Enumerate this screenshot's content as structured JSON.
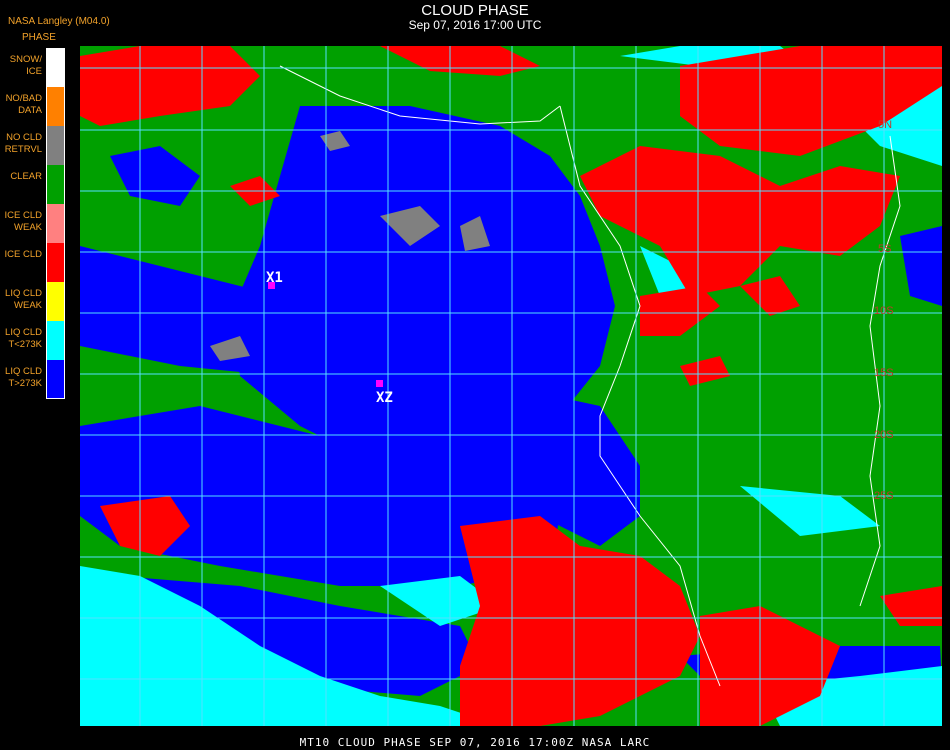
{
  "header": {
    "source": "NASA Langley (M04.0)",
    "legend_title": "PHASE",
    "title": "CLOUD PHASE",
    "subtitle": "Sep 07, 2016 17:00 UTC"
  },
  "legend": [
    {
      "label": "SNOW/\nICE",
      "color": "#ffffff"
    },
    {
      "label": "NO/BAD\nDATA",
      "color": "#ff8000"
    },
    {
      "label": "NO CLD\nRETRVL",
      "color": "#808080"
    },
    {
      "label": "CLEAR",
      "color": "#00a000"
    },
    {
      "label": "ICE CLD\nWEAK",
      "color": "#ff8080"
    },
    {
      "label": "ICE CLD",
      "color": "#ff0000"
    },
    {
      "label": "LIQ CLD\nWEAK",
      "color": "#ffff00"
    },
    {
      "label": "LIQ CLD\nT<273K",
      "color": "#00ffff"
    },
    {
      "label": "LIQ CLD\nT>273K",
      "color": "#0000ff"
    }
  ],
  "markers": [
    {
      "label": "X1",
      "color": "#ff00ff"
    },
    {
      "label": "XZ",
      "color": "#ff00ff"
    }
  ],
  "lat_labels": [
    "5N",
    "5S",
    "10S",
    "15S",
    "20S",
    "25S"
  ],
  "colors": {
    "clear": "#00a000",
    "liq_warm": "#0000ff",
    "liq_cold": "#00ffff",
    "ice": "#ff0000",
    "no_retrieval": "#808080",
    "grid": "#55e0ff",
    "coast": "#ffffff"
  },
  "footer": "MT10  CLOUD PHASE   SEP 07, 2016 17:00Z   NASA LARC"
}
